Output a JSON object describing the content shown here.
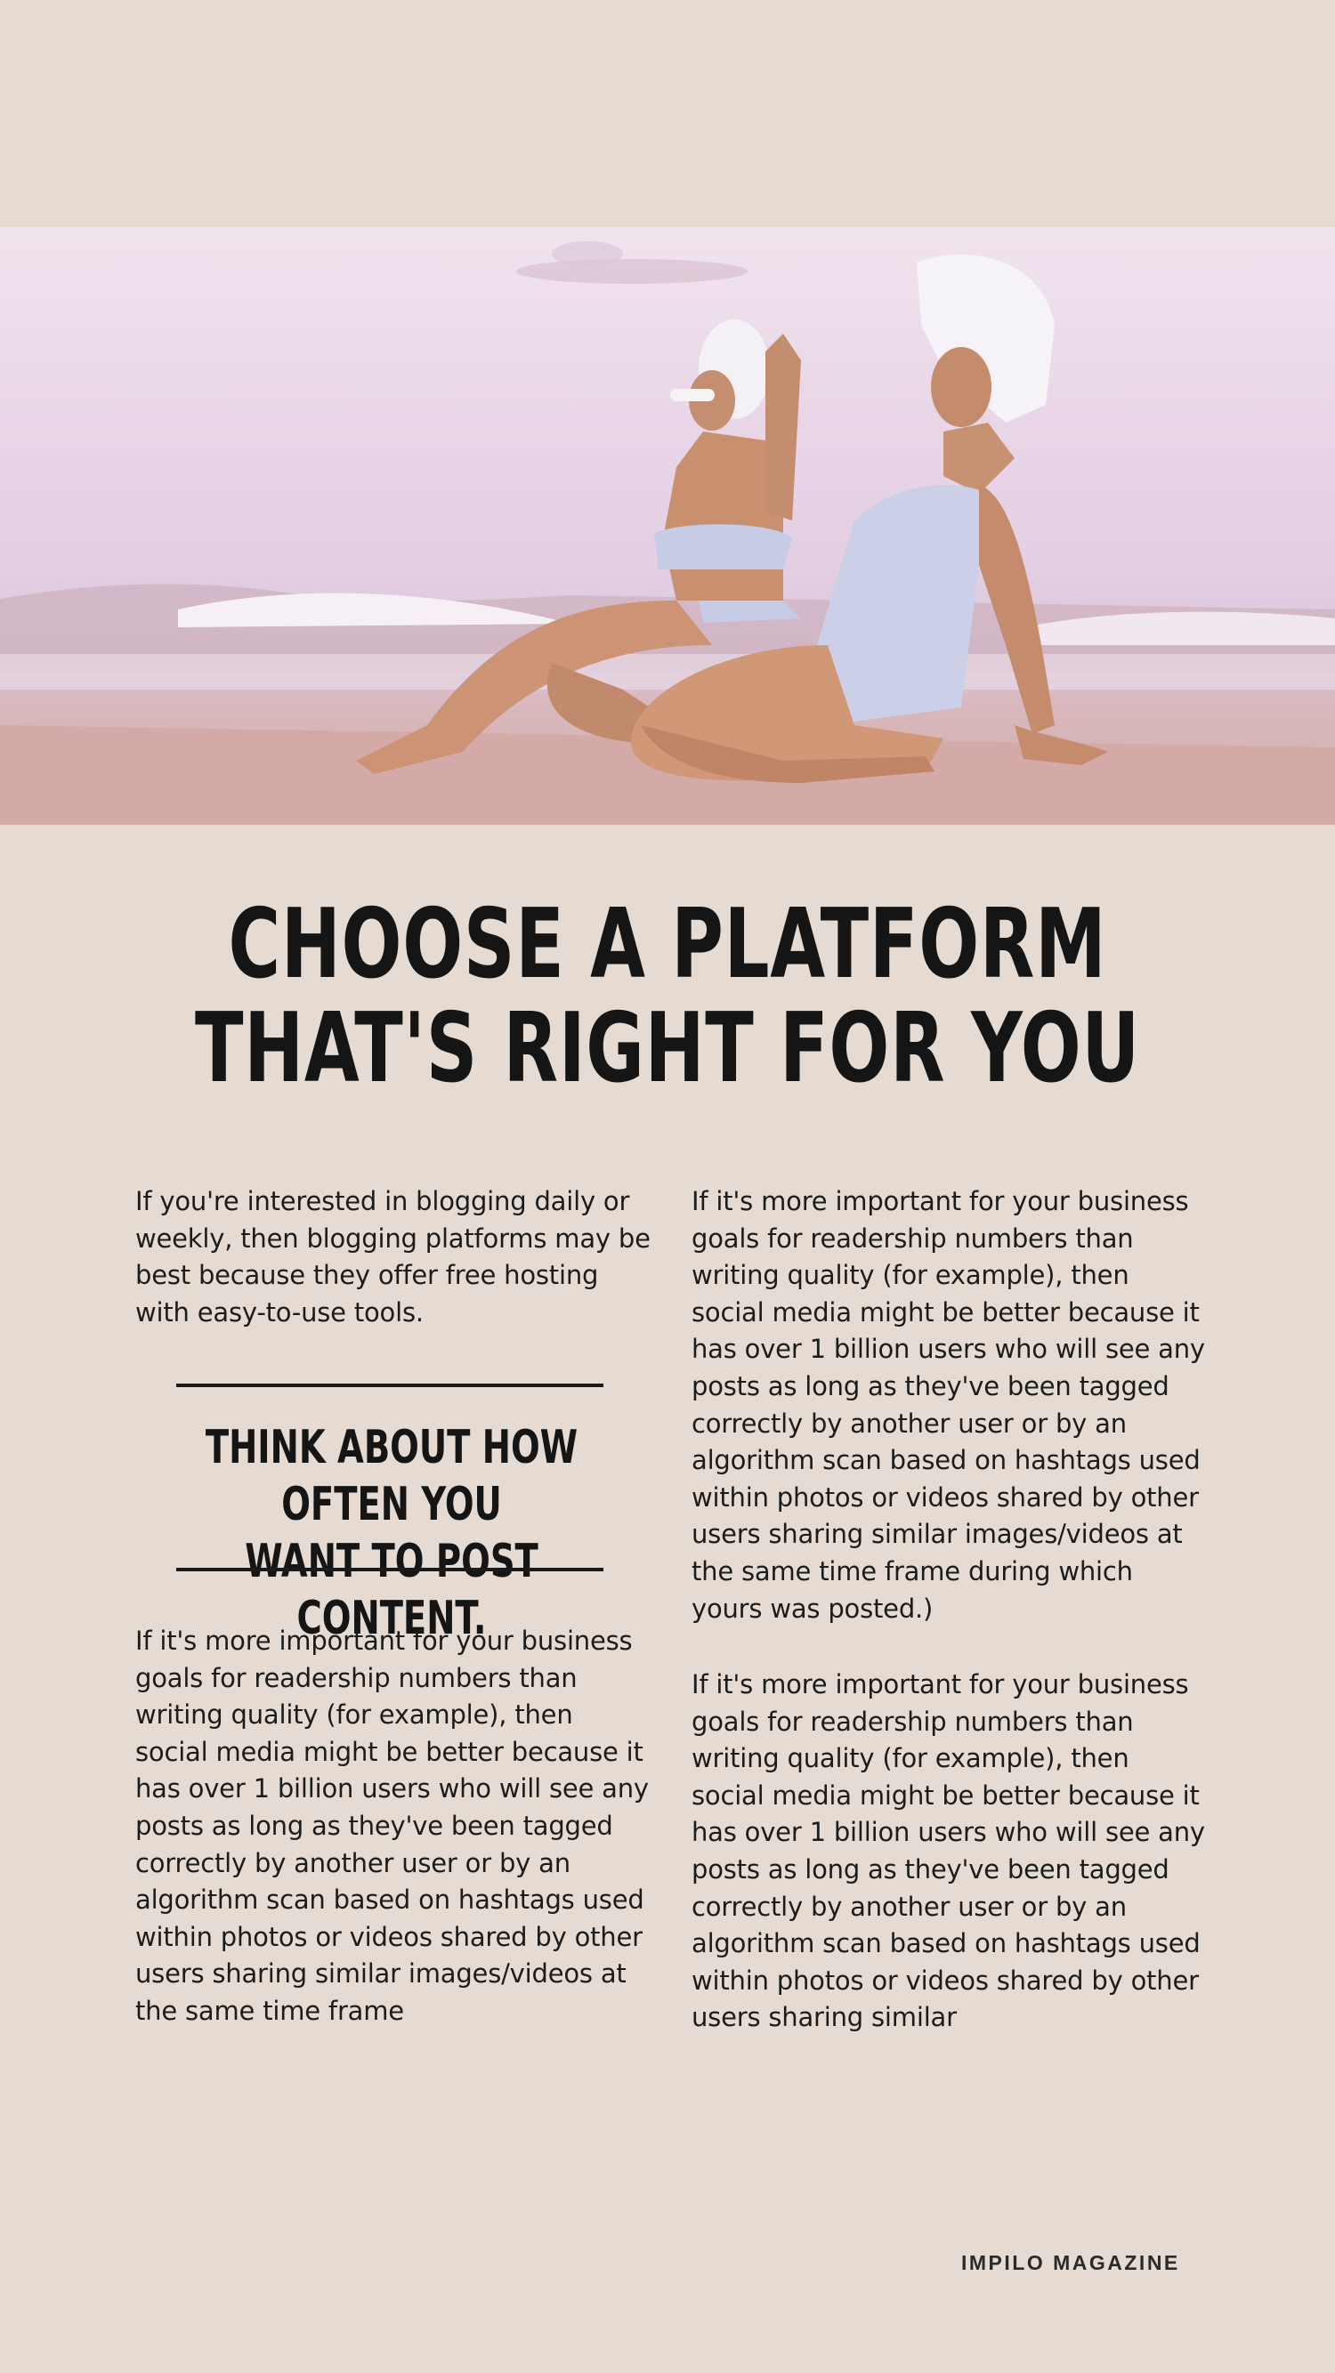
{
  "hero": {
    "image_icon": "beach-photo-two-women-in-swimsuits"
  },
  "headline": {
    "line1": "CHOOSE A PLATFORM",
    "line2": "THAT'S RIGHT FOR YOU"
  },
  "left_column": {
    "intro": "If you're interested in blogging daily or weekly, then blogging platforms may be best because they offer free hosting with easy-to-use tools.",
    "callout_line1": "THINK ABOUT HOW OFTEN YOU",
    "callout_line2": "WANT TO POST CONTENT.",
    "paragraph": "If it's more important for your business goals for readership numbers than writing quality (for example), then social media might be better because it has over 1 billion users who will see any posts as long as they've been tagged correctly by another user or by an algorithm scan based on hashtags used within photos or videos shared by other users sharing similar images/videos at the same time frame"
  },
  "right_column": {
    "paragraph1": "If it's more important for your business goals for readership numbers than writing quality (for example), then social media might be better because it has over 1 billion users who will see any posts as long as they've been tagged correctly by another user or by an algorithm scan based on hashtags used within photos or videos shared by other users sharing similar images/videos at the same time frame during which yours was posted.)",
    "paragraph2": "If it's more important for your business goals for readership numbers than writing quality (for example), then social media might be better because it has over 1 billion users who will see any posts as long as they've been tagged correctly by another user or by an algorithm scan based on hashtags used within photos or videos shared by other users sharing similar"
  },
  "footer": {
    "brand": "IMPILO MAGAZINE"
  },
  "colors": {
    "background": "#e5dbd2",
    "text": "#151515"
  }
}
